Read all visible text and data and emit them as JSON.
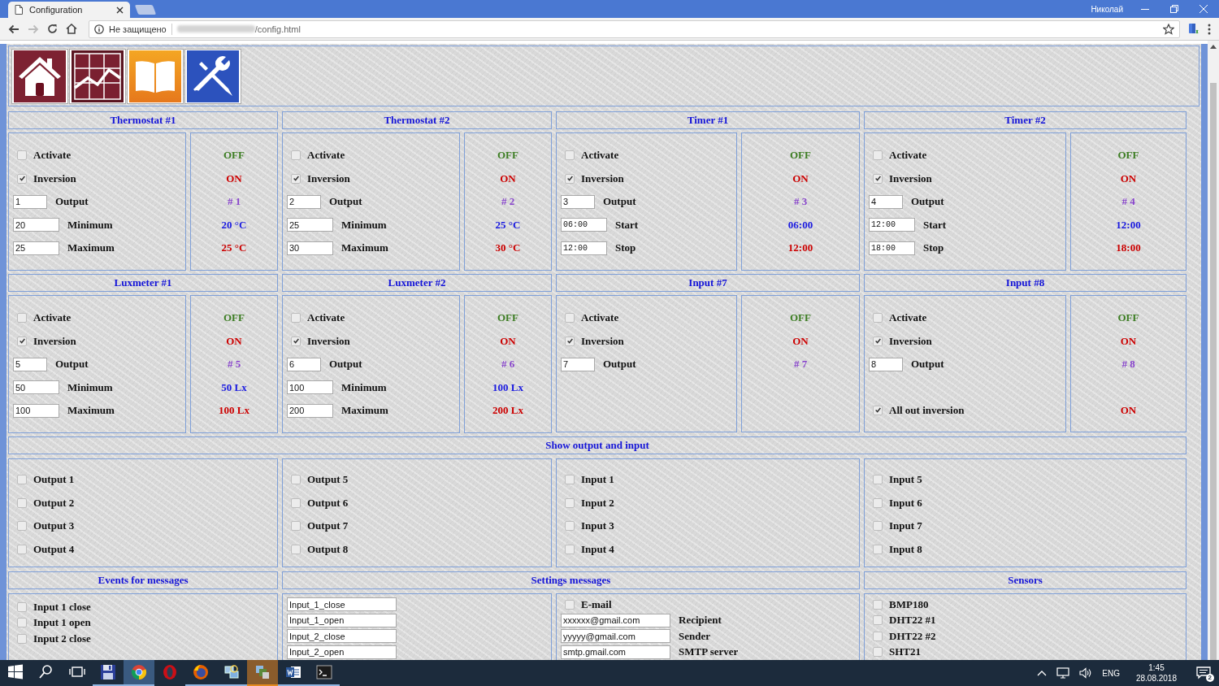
{
  "browser": {
    "tab_title": "Configuration",
    "user": "Николай",
    "security": "Не защищено",
    "address": "/config.html",
    "forward_disabled": true
  },
  "nav": [
    {
      "kind": "home"
    },
    {
      "kind": "chart"
    },
    {
      "kind": "book"
    },
    {
      "kind": "tools"
    }
  ],
  "modules": [
    {
      "title": "Thermostat #1",
      "rows": [
        {
          "kind": "checkbox",
          "label": "Activate",
          "checked": false,
          "status": "OFF",
          "color": "#3c7d22"
        },
        {
          "kind": "checkbox",
          "label": "Inversion",
          "checked": true,
          "status": "ON",
          "color": "#cc0000"
        },
        {
          "kind": "index",
          "value": "1",
          "label": "Output",
          "status": "# 1",
          "color": "#8844cc"
        },
        {
          "kind": "field",
          "value": "20",
          "label": "Minimum",
          "status": "20 °C",
          "color": "#1a1ae0"
        },
        {
          "kind": "field",
          "value": "25",
          "label": "Maximum",
          "status": "25 °C",
          "color": "#cc0000"
        }
      ]
    },
    {
      "title": "Thermostat #2",
      "rows": [
        {
          "kind": "checkbox",
          "label": "Activate",
          "checked": false,
          "status": "OFF",
          "color": "#3c7d22"
        },
        {
          "kind": "checkbox",
          "label": "Inversion",
          "checked": true,
          "status": "ON",
          "color": "#cc0000"
        },
        {
          "kind": "index",
          "value": "2",
          "label": "Output",
          "status": "# 2",
          "color": "#8844cc"
        },
        {
          "kind": "field",
          "value": "25",
          "label": "Minimum",
          "status": "25 °C",
          "color": "#1a1ae0"
        },
        {
          "kind": "field",
          "value": "30",
          "label": "Maximum",
          "status": "30 °C",
          "color": "#cc0000"
        }
      ]
    },
    {
      "title": "Timer #1",
      "rows": [
        {
          "kind": "checkbox",
          "label": "Activate",
          "checked": false,
          "status": "OFF",
          "color": "#3c7d22"
        },
        {
          "kind": "checkbox",
          "label": "Inversion",
          "checked": true,
          "status": "ON",
          "color": "#cc0000"
        },
        {
          "kind": "index",
          "value": "3",
          "label": "Output",
          "status": "# 3",
          "color": "#8844cc"
        },
        {
          "kind": "time",
          "value": "06:00",
          "label": "Start",
          "status": "06:00",
          "color": "#1a1ae0"
        },
        {
          "kind": "time",
          "value": "12:00",
          "label": "Stop",
          "status": "12:00",
          "color": "#cc0000"
        }
      ]
    },
    {
      "title": "Timer #2",
      "rows": [
        {
          "kind": "checkbox",
          "label": "Activate",
          "checked": false,
          "status": "OFF",
          "color": "#3c7d22"
        },
        {
          "kind": "checkbox",
          "label": "Inversion",
          "checked": true,
          "status": "ON",
          "color": "#cc0000"
        },
        {
          "kind": "index",
          "value": "4",
          "label": "Output",
          "status": "# 4",
          "color": "#8844cc"
        },
        {
          "kind": "time",
          "value": "12:00",
          "label": "Start",
          "status": "12:00",
          "color": "#1a1ae0"
        },
        {
          "kind": "time",
          "value": "18:00",
          "label": "Stop",
          "status": "18:00",
          "color": "#cc0000"
        }
      ]
    },
    {
      "title": "Luxmeter #1",
      "rows": [
        {
          "kind": "checkbox",
          "label": "Activate",
          "checked": false,
          "status": "OFF",
          "color": "#3c7d22"
        },
        {
          "kind": "checkbox",
          "label": "Inversion",
          "checked": true,
          "status": "ON",
          "color": "#cc0000"
        },
        {
          "kind": "index",
          "value": "5",
          "label": "Output",
          "status": "# 5",
          "color": "#8844cc"
        },
        {
          "kind": "field",
          "value": "50",
          "label": "Minimum",
          "status": "50 Lx",
          "color": "#1a1ae0"
        },
        {
          "kind": "field",
          "value": "100",
          "label": "Maximum",
          "status": "100 Lx",
          "color": "#cc0000"
        }
      ]
    },
    {
      "title": "Luxmeter #2",
      "rows": [
        {
          "kind": "checkbox",
          "label": "Activate",
          "checked": false,
          "status": "OFF",
          "color": "#3c7d22"
        },
        {
          "kind": "checkbox",
          "label": "Inversion",
          "checked": true,
          "status": "ON",
          "color": "#cc0000"
        },
        {
          "kind": "index",
          "value": "6",
          "label": "Output",
          "status": "# 6",
          "color": "#8844cc"
        },
        {
          "kind": "field",
          "value": "100",
          "label": "Minimum",
          "status": "100 Lx",
          "color": "#1a1ae0"
        },
        {
          "kind": "field",
          "value": "200",
          "label": "Maximum",
          "status": "200 Lx",
          "color": "#cc0000"
        }
      ]
    },
    {
      "title": "Input #7",
      "rows": [
        {
          "kind": "checkbox",
          "label": "Activate",
          "checked": false,
          "status": "OFF",
          "color": "#3c7d22"
        },
        {
          "kind": "checkbox",
          "label": "Inversion",
          "checked": true,
          "status": "ON",
          "color": "#cc0000"
        },
        {
          "kind": "index",
          "value": "7",
          "label": "Output",
          "status": "# 7",
          "color": "#8844cc"
        }
      ]
    },
    {
      "title": "Input #8",
      "rows": [
        {
          "kind": "checkbox",
          "label": "Activate",
          "checked": false,
          "status": "OFF",
          "color": "#3c7d22"
        },
        {
          "kind": "checkbox",
          "label": "Inversion",
          "checked": true,
          "status": "ON",
          "color": "#cc0000"
        },
        {
          "kind": "index",
          "value": "8",
          "label": "Output",
          "status": "# 8",
          "color": "#8844cc"
        },
        {
          "kind": "footer",
          "label": "All out inversion",
          "checked": true,
          "status": "ON",
          "color": "#cc0000"
        }
      ]
    }
  ],
  "show_io": {
    "title": "Show output and input",
    "groups": [
      [
        {
          "label": "Output 1",
          "checked": false
        },
        {
          "label": "Output 2",
          "checked": false
        },
        {
          "label": "Output 3",
          "checked": false
        },
        {
          "label": "Output 4",
          "checked": false
        }
      ],
      [
        {
          "label": "Output 5",
          "checked": false
        },
        {
          "label": "Output 6",
          "checked": false
        },
        {
          "label": "Output 7",
          "checked": false
        },
        {
          "label": "Output 8",
          "checked": false
        }
      ],
      [
        {
          "label": "Input 1",
          "checked": false
        },
        {
          "label": "Input 2",
          "checked": false
        },
        {
          "label": "Input 3",
          "checked": false
        },
        {
          "label": "Input 4",
          "checked": false
        }
      ],
      [
        {
          "label": "Input 5",
          "checked": false
        },
        {
          "label": "Input 6",
          "checked": false
        },
        {
          "label": "Input 7",
          "checked": false
        },
        {
          "label": "Input 8",
          "checked": false
        }
      ]
    ]
  },
  "events": {
    "title": "Events for messages",
    "items": [
      {
        "label": "Input 1 close",
        "checked": false
      },
      {
        "label": "Input 1 open",
        "checked": false
      },
      {
        "label": "Input 2 close",
        "checked": false
      }
    ]
  },
  "settings": {
    "title": "Settings messages",
    "templates": [
      "Input_1_close",
      "Input_1_open",
      "Input_2_close",
      "Input_2_open"
    ],
    "email": {
      "label": "E-mail",
      "checked": false
    },
    "fields": [
      {
        "value": "xxxxxx@gmail.com",
        "label": "Recipient"
      },
      {
        "value": "yyyyy@gmail.com",
        "label": "Sender"
      },
      {
        "value": "smtp.gmail.com",
        "label": "SMTP server"
      }
    ]
  },
  "sensors": {
    "title": "Sensors",
    "items": [
      {
        "label": "BMP180",
        "checked": false
      },
      {
        "label": "DHT22 #1",
        "checked": false
      },
      {
        "label": "DHT22 #2",
        "checked": false
      },
      {
        "label": "SHT21",
        "checked": false
      }
    ]
  },
  "taskbar": {
    "apps": [
      {
        "kind": "start"
      },
      {
        "kind": "search"
      },
      {
        "kind": "taskview"
      },
      {
        "kind": "floppy",
        "running": true
      },
      {
        "kind": "chrome",
        "running": true,
        "active": true
      },
      {
        "kind": "opera",
        "running": false
      },
      {
        "kind": "firefox",
        "running": true
      },
      {
        "kind": "network",
        "running": true
      },
      {
        "kind": "windows",
        "running": true,
        "attention": true
      },
      {
        "kind": "word",
        "running": true
      },
      {
        "kind": "terminal",
        "running": true
      }
    ],
    "language": "ENG",
    "time": "1:45",
    "date": "28.08.2018",
    "notifications": "2"
  }
}
